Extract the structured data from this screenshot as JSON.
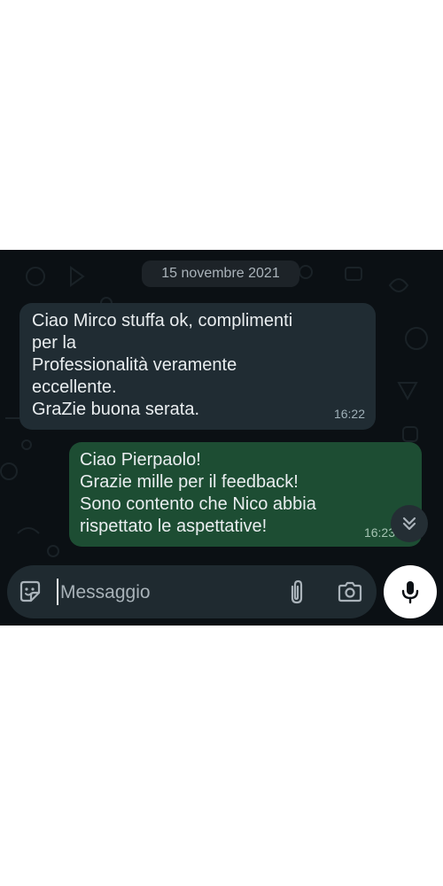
{
  "chat": {
    "date_separator": "15 novembre 2021",
    "messages": [
      {
        "direction": "incoming",
        "lines": [
          "Ciao Mirco stuffa ok, complimenti",
          "per la",
          "Professionalità veramente",
          "eccellente.",
          "GraZie buona serata."
        ],
        "time": "16:22"
      },
      {
        "direction": "outgoing",
        "lines": [
          "Ciao Pierpaolo!",
          "Grazie mille per il feedback!",
          "Sono contento che Nico abbia",
          "rispettato le aspettative!"
        ],
        "time": "16:23"
      }
    ]
  },
  "composer": {
    "placeholder": "Messaggio",
    "icons": [
      "sticker-icon",
      "paperclip-icon",
      "camera-icon",
      "microphone-icon",
      "double-chevron-down-icon"
    ]
  },
  "colors": {
    "background": "#0b1014",
    "incoming_bubble": "#202c33",
    "outgoing_bubble": "#1d4d33",
    "text": "#e9edef"
  }
}
